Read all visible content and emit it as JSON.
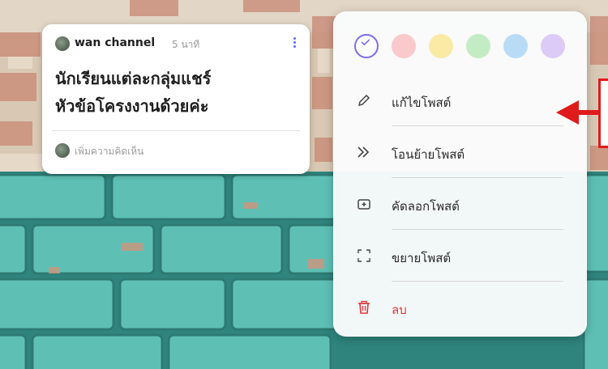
{
  "post": {
    "author": "wan channel",
    "time": "5 นาที",
    "title": "นักเรียนแต่ละกลุ่มแชร์\nหัวข้อโครงงานด้วยค่ะ",
    "comment_placeholder": "เพิ่มความคิดเห็น"
  },
  "menu": {
    "colors": [
      {
        "name": "default",
        "hex": "#ffffff",
        "selected": true
      },
      {
        "name": "red",
        "hex": "#f9c9cc",
        "selected": false
      },
      {
        "name": "yellow",
        "hex": "#fbeaa5",
        "selected": false
      },
      {
        "name": "green",
        "hex": "#c4ecc4",
        "selected": false
      },
      {
        "name": "blue",
        "hex": "#b8dcf6",
        "selected": false
      },
      {
        "name": "purple",
        "hex": "#dccbf7",
        "selected": false
      }
    ],
    "items": [
      {
        "label": "แก้ไขโพสต์",
        "icon": "pencil-icon"
      },
      {
        "label": "โอนย้ายโพสต์",
        "icon": "double-chevron-right-icon"
      },
      {
        "label": "คัดลอกโพสต์",
        "icon": "duplicate-icon"
      },
      {
        "label": "ขยายโพสต์",
        "icon": "expand-icon"
      },
      {
        "label": "ลบ",
        "icon": "trash-icon"
      }
    ]
  },
  "colors": {
    "accent": "#7c6cf0",
    "delete": "#e0383e",
    "callout": "#e01b1b",
    "wall_teal": "#4fb2a8"
  }
}
